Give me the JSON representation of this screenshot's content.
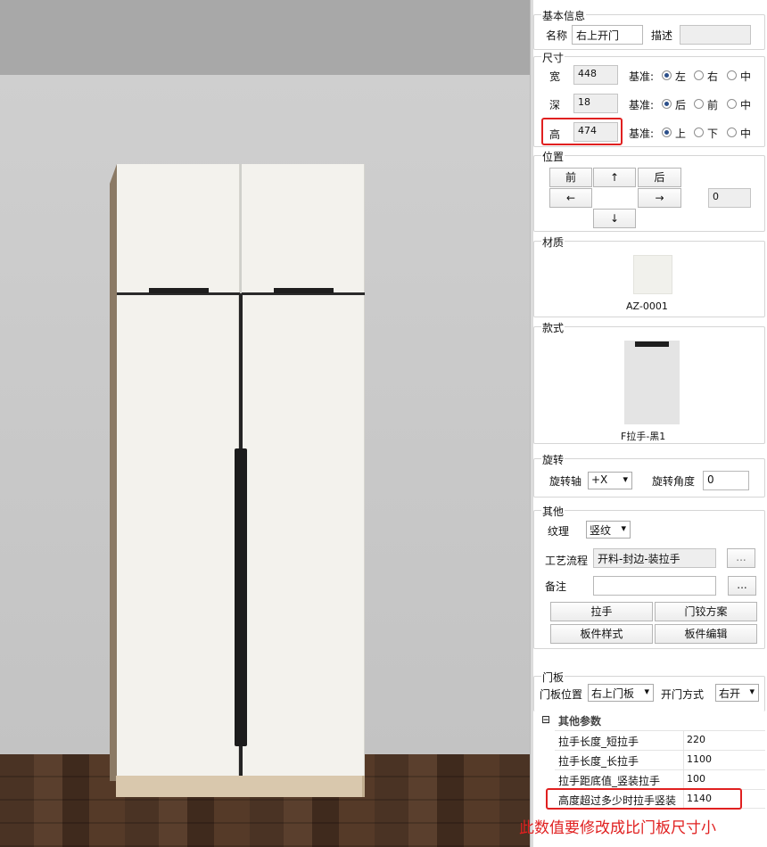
{
  "basic": {
    "title": "基本信息",
    "name_label": "名称",
    "name_value": "右上开门",
    "desc_label": "描述",
    "desc_value": ""
  },
  "size": {
    "title": "尺寸",
    "base_label": "基准:",
    "rows": [
      {
        "label": "宽",
        "value": "448",
        "options": [
          "左",
          "右",
          "中"
        ],
        "selected": "左"
      },
      {
        "label": "深",
        "value": "18",
        "options": [
          "后",
          "前",
          "中"
        ],
        "selected": "后"
      },
      {
        "label": "高",
        "value": "474",
        "options": [
          "上",
          "下",
          "中"
        ],
        "selected": "上"
      }
    ]
  },
  "position": {
    "title": "位置",
    "front": "前",
    "back": "后",
    "up": "↑",
    "down": "↓",
    "left": "←",
    "right": "→",
    "value": "0"
  },
  "material": {
    "title": "材质",
    "code": "AZ-0001",
    "swatch_color": "#f1f1ec"
  },
  "style": {
    "title": "款式",
    "name": "F拉手-黑1"
  },
  "rotation": {
    "title": "旋转",
    "axis_label": "旋转轴",
    "axis_value": "+X",
    "angle_label": "旋转角度",
    "angle_value": "0"
  },
  "other": {
    "title": "其他",
    "texture_label": "纹理",
    "texture_value": "竖纹",
    "process_label": "工艺流程",
    "process_value": "开料-封边-装拉手",
    "note_label": "备注",
    "note_value": "",
    "more": "...",
    "buttons": [
      "拉手",
      "门铰方案",
      "板件样式",
      "板件编辑"
    ]
  },
  "door": {
    "title": "门板",
    "pos_label": "门板位置",
    "pos_value": "右上门板",
    "open_label": "开门方式",
    "open_value": "右开"
  },
  "params": {
    "toggle": "⊟",
    "title": "其他参数",
    "rows": [
      {
        "key": "拉手长度_短拉手",
        "value": "220"
      },
      {
        "key": "拉手长度_长拉手",
        "value": "1100"
      },
      {
        "key": "拉手距底值_竖装拉手",
        "value": "100"
      },
      {
        "key": "高度超过多少时拉手竖装",
        "value": "1140"
      }
    ]
  },
  "annotation": {
    "text": "此数值要修改成比门板尺寸小",
    "color": "#e02020"
  }
}
